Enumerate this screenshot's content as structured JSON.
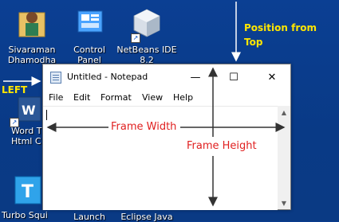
{
  "desktop": {
    "icons": [
      {
        "label": "Sivaraman\nDhamodha",
        "icon": "user-folder-icon"
      },
      {
        "label": "Control\nPanel",
        "icon": "control-panel-icon"
      },
      {
        "label": "NetBeans IDE\n8.2",
        "icon": "netbeans-icon"
      },
      {
        "label": "Word T\nHtml C",
        "icon": "word-icon"
      },
      {
        "label": "Turbo Squid",
        "icon": "turbo-squid-icon"
      },
      {
        "label": "Launch",
        "icon": "launch-icon"
      },
      {
        "label": "Eclipse Java",
        "icon": "eclipse-icon"
      }
    ]
  },
  "annotations": {
    "position_from_top": "Position from\nTop",
    "left": "LEFT",
    "frame_width": "Frame Width",
    "frame_height": "Frame Height"
  },
  "window": {
    "title": "Untitled - Notepad",
    "controls": {
      "minimize": "—",
      "maximize": "☐",
      "close": "✕"
    },
    "menu": [
      "File",
      "Edit",
      "Format",
      "View",
      "Help"
    ]
  },
  "colors": {
    "annotation_yellow": "#ffe600",
    "annotation_red": "#e02020",
    "desktop_blue": "#0a3d8f"
  }
}
